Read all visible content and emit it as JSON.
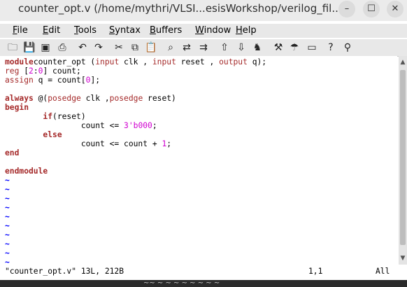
{
  "window": {
    "title": "counter_opt.v (/home/mythri/VLSI...esisWorkshop/verilog_fil...",
    "minimize_glyph": "–",
    "maximize_glyph": "☐",
    "close_glyph": "✕"
  },
  "menu": {
    "items": [
      {
        "first": "F",
        "rest": "ile"
      },
      {
        "first": "E",
        "rest": "dit"
      },
      {
        "first": "T",
        "rest": "ools"
      },
      {
        "first": "S",
        "rest": "yntax"
      },
      {
        "first": "B",
        "rest": "uffers"
      },
      {
        "first": "W",
        "rest": "indow"
      },
      {
        "first": "H",
        "rest": "elp"
      }
    ]
  },
  "toolbar": {
    "icons": [
      "open-icon",
      "save-icon",
      "save-all-icon",
      "print-icon",
      "undo-icon",
      "redo-icon",
      "cut-icon",
      "copy-icon",
      "paste-icon",
      "find-icon",
      "replace-icon",
      "find-next-icon",
      "load-session-icon",
      "save-session-icon",
      "run-script-icon",
      "make-icon",
      "ctags-icon",
      "jump-tag-icon",
      "help-icon",
      "find-help-icon"
    ],
    "glyphs": [
      "🗀",
      "💾",
      "▣",
      "⎙",
      "↶",
      "↷",
      "✂",
      "⧉",
      "📋",
      "⌕",
      "⇄",
      "⇉",
      "⇧",
      "⇩",
      "♞",
      "⚒",
      "☂",
      "▭",
      "?",
      "⚲"
    ]
  },
  "editor": {
    "lines": [
      [
        [
          "kw",
          "module"
        ],
        [
          "",
          "counter_opt ("
        ],
        [
          "ty",
          "input"
        ],
        [
          "",
          " clk , "
        ],
        [
          "ty",
          "input"
        ],
        [
          "",
          " reset , "
        ],
        [
          "ty",
          "output"
        ],
        [
          "",
          " q);"
        ]
      ],
      [
        [
          "ty",
          "reg"
        ],
        [
          "",
          " ["
        ],
        [
          "nm",
          "2"
        ],
        [
          "",
          ":"
        ],
        [
          "nm",
          "0"
        ],
        [
          "",
          "] count;"
        ]
      ],
      [
        [
          "ty",
          "assign"
        ],
        [
          "",
          " q = count["
        ],
        [
          "nm",
          "0"
        ],
        [
          "",
          "];"
        ]
      ],
      [
        [
          "",
          ""
        ]
      ],
      [
        [
          "kw",
          "always"
        ],
        [
          "",
          " @("
        ],
        [
          "ty",
          "posedge"
        ],
        [
          "",
          " clk ,"
        ],
        [
          "ty",
          "posedge"
        ],
        [
          "",
          " reset)"
        ]
      ],
      [
        [
          "kw",
          "begin"
        ]
      ],
      [
        [
          "",
          "        "
        ],
        [
          "kw",
          "if"
        ],
        [
          "",
          "(reset)"
        ]
      ],
      [
        [
          "",
          "                count <= "
        ],
        [
          "nm",
          "3'b000"
        ],
        [
          "",
          ";"
        ]
      ],
      [
        [
          "",
          "        "
        ],
        [
          "kw",
          "else"
        ]
      ],
      [
        [
          "",
          "                count <= count + "
        ],
        [
          "nm",
          "1"
        ],
        [
          "",
          ";"
        ]
      ],
      [
        [
          "kw",
          "end"
        ]
      ],
      [
        [
          "",
          ""
        ]
      ],
      [
        [
          "kw",
          "endmodule"
        ]
      ]
    ],
    "tilde": "~",
    "tilde_count": 10
  },
  "status": {
    "file_info": "\"counter_opt.v\" 13L, 212B",
    "position": "1,1",
    "scroll": "All"
  },
  "behind_text": "~~ ~ ~ ~ ~ ~ ~ ~ ~"
}
